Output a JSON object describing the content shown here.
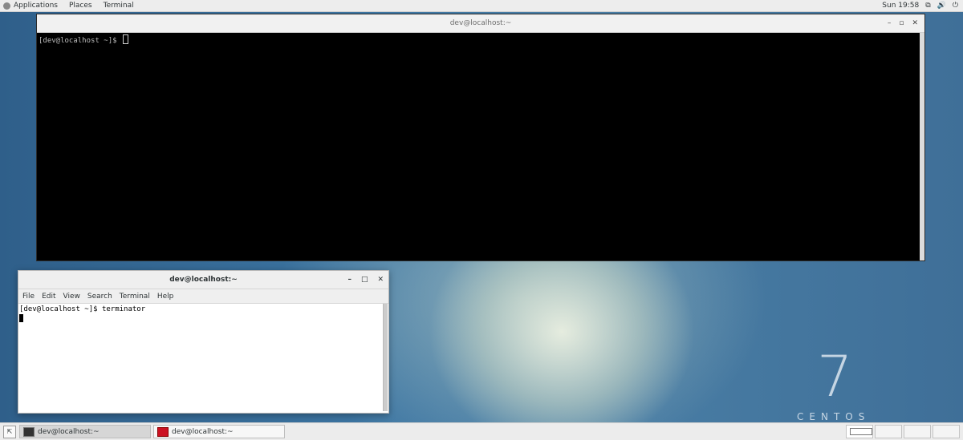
{
  "topbar": {
    "menu": [
      "Applications",
      "Places",
      "Terminal"
    ],
    "clock": "Sun 19:58",
    "tray_icons": [
      "network-icon",
      "volume-icon",
      "power-icon"
    ]
  },
  "terminator_window": {
    "title": "dev@localhost:~",
    "prompt": "[dev@localhost ~]$ "
  },
  "gnome_terminal_window": {
    "title": "dev@localhost:~",
    "menu": [
      "File",
      "Edit",
      "View",
      "Search",
      "Terminal",
      "Help"
    ],
    "lines": [
      "[dev@localhost ~]$ terminator"
    ]
  },
  "taskbar": {
    "tasks": [
      {
        "label": "dev@localhost:~",
        "active": true
      },
      {
        "label": "dev@localhost:~",
        "active": false
      }
    ],
    "workspace_count": 4
  },
  "wallpaper": {
    "number": "7",
    "word": "CENTOS"
  },
  "colors": {
    "terminal_bg": "#000000",
    "terminal_fg": "#bbbbbb",
    "panel_bg": "#ededed"
  }
}
